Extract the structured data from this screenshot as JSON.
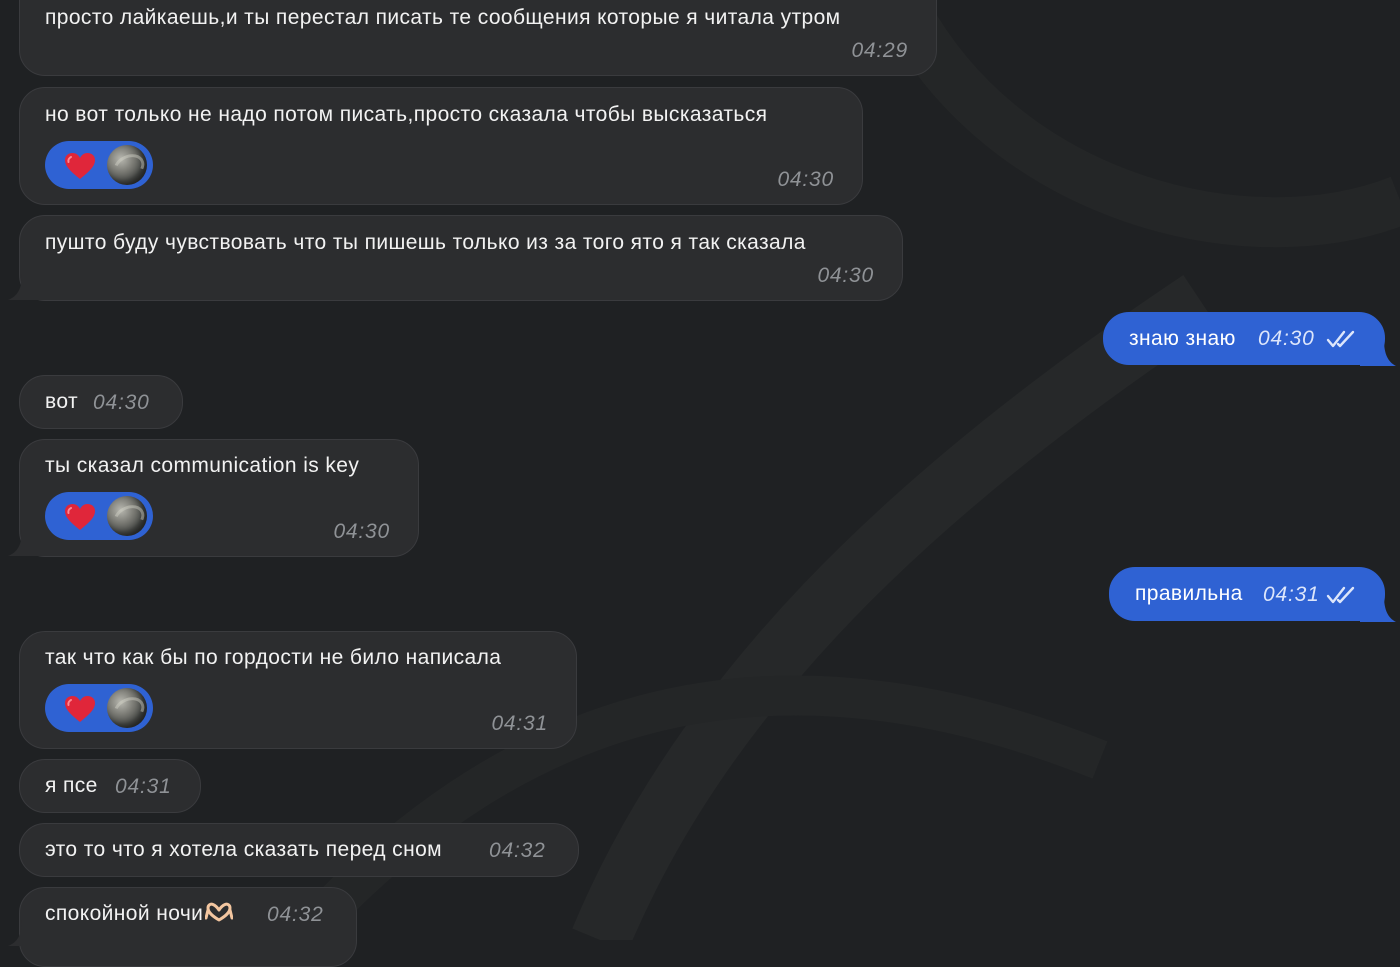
{
  "colors": {
    "background": "#1f2123",
    "incoming_bubble": "#2c2d2f",
    "outgoing_bubble": "#2f62d3",
    "reaction_pill": "#2f62d3",
    "heart": "#e0263a"
  },
  "messages": [
    {
      "direction": "in",
      "text": "просто лайкаешь,и ты перестал писать те сообщения которые я читала утром",
      "time": "04:29"
    },
    {
      "direction": "in",
      "text": "но вот только не надо потом писать,просто сказала чтобы высказаться",
      "time": "04:30",
      "reaction": {
        "icon": "heart-icon"
      }
    },
    {
      "direction": "in",
      "text": "пушто буду чувствовать что ты пишешь только из за того ято я так сказала",
      "time": "04:30"
    },
    {
      "direction": "out",
      "text": "знаю знаю",
      "time": "04:30",
      "status_icon": "double-check-icon"
    },
    {
      "direction": "in",
      "text": "вот",
      "time": "04:30"
    },
    {
      "direction": "in",
      "text": "ты сказал communication is key",
      "time": "04:30",
      "reaction": {
        "icon": "heart-icon"
      }
    },
    {
      "direction": "out",
      "text": "правильна",
      "time": "04:31",
      "status_icon": "double-check-icon"
    },
    {
      "direction": "in",
      "text": "так что как бы по гордости не било написала",
      "time": "04:31",
      "reaction": {
        "icon": "heart-icon"
      }
    },
    {
      "direction": "in",
      "text": "я псе",
      "time": "04:31"
    },
    {
      "direction": "in",
      "text": "это то что я хотела сказать перед сном",
      "time": "04:32"
    },
    {
      "direction": "in",
      "text": "спокойной ночи",
      "time": "04:32",
      "emoji": "heart-hands-icon"
    }
  ]
}
